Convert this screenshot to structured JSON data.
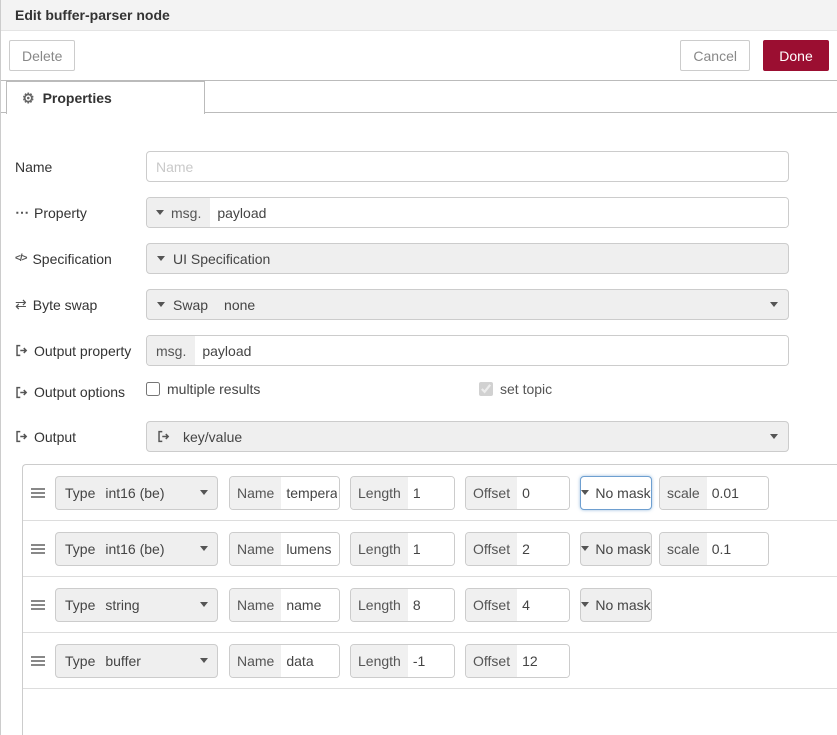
{
  "dialog": {
    "title": "Edit buffer-parser node",
    "buttons": {
      "delete": "Delete",
      "cancel": "Cancel",
      "done": "Done"
    },
    "tab_label": "Properties"
  },
  "icons": {
    "gear": "⚙",
    "ellipsis": "⋯",
    "code": "</>",
    "swap": "⇄"
  },
  "form": {
    "name": {
      "label": "Name",
      "placeholder": "Name"
    },
    "property": {
      "label": "Property",
      "prefix": "msg.",
      "value": "payload"
    },
    "specification": {
      "label": "Specification",
      "value": "UI Specification"
    },
    "byteswap": {
      "label": "Byte swap",
      "prefix": "Swap",
      "value": "none"
    },
    "output_property": {
      "label": "Output property",
      "prefix": "msg.",
      "value": "payload"
    },
    "output_options": {
      "label": "Output options",
      "multiple_results": "multiple results",
      "set_topic": "set topic"
    },
    "output": {
      "label": "Output",
      "value": "key/value"
    }
  },
  "row_labels": {
    "type": "Type",
    "name": "Name",
    "length": "Length",
    "offset": "Offset",
    "scale": "scale"
  },
  "items": [
    {
      "type": "int16 (be)",
      "name": "temperatu",
      "length": "1",
      "offset": "0",
      "mask": "No mask",
      "scale": "0.01"
    },
    {
      "type": "int16 (be)",
      "name": "lumens",
      "length": "1",
      "offset": "2",
      "mask": "No mask",
      "scale": "0.1"
    },
    {
      "type": "string",
      "name": "name",
      "length": "8",
      "offset": "4",
      "mask": "No mask"
    },
    {
      "type": "buffer",
      "name": "data",
      "length": "-1",
      "offset": "12"
    }
  ],
  "colors": {
    "accent": "#9b0e31",
    "focus": "#6e9fd0",
    "field_gray": "#efefef"
  }
}
